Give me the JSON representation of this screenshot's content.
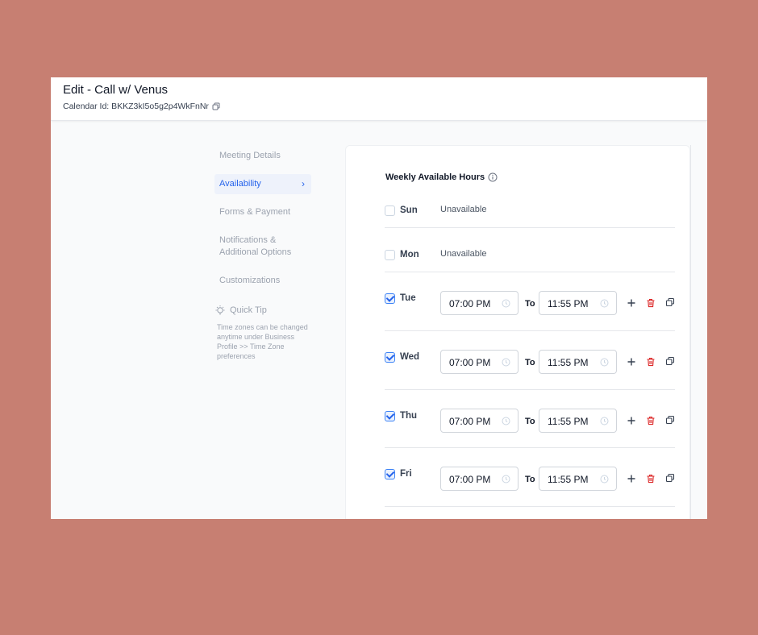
{
  "header": {
    "title": "Edit - Call w/ Venus",
    "calendar_id": "Calendar Id: BKKZ3kI5o5g2p4WkFnNr"
  },
  "nav": {
    "items": [
      {
        "label": "Meeting Details"
      },
      {
        "label": "Availability",
        "active": true
      },
      {
        "label": "Forms & Payment"
      },
      {
        "label": "Notifications &\nAdditional Options"
      },
      {
        "label": "Customizations"
      }
    ]
  },
  "tip": {
    "title": "Quick Tip",
    "text": "Time zones can be changed anytime under Business Profile >> Time Zone preferences"
  },
  "availability": {
    "heading": "Weekly Available Hours",
    "to_label": "To",
    "days": [
      {
        "day": "Sun",
        "checked": false,
        "status": "Unavailable"
      },
      {
        "day": "Mon",
        "checked": false,
        "status": "Unavailable"
      },
      {
        "day": "Tue",
        "checked": true,
        "start": "07:00 PM",
        "end": "11:55 PM"
      },
      {
        "day": "Wed",
        "checked": true,
        "start": "07:00 PM",
        "end": "11:55 PM"
      },
      {
        "day": "Thu",
        "checked": true,
        "start": "07:00 PM",
        "end": "11:55 PM"
      },
      {
        "day": "Fri",
        "checked": true,
        "start": "07:00 PM",
        "end": "11:55 PM"
      }
    ]
  },
  "colors": {
    "background": "#c77f72",
    "accent": "#2563eb",
    "delete": "#dc2626"
  }
}
